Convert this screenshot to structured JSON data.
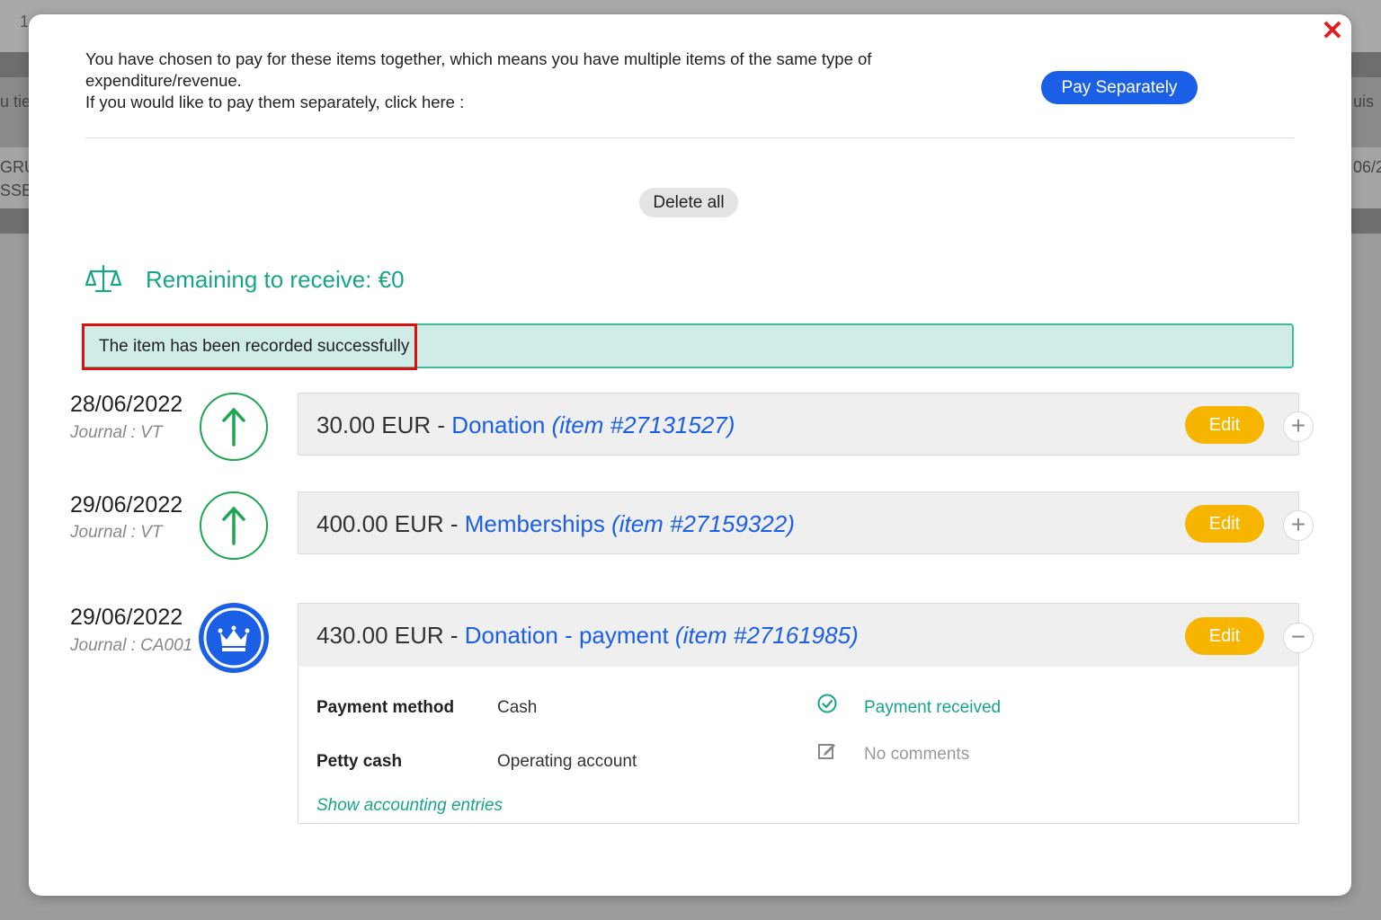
{
  "background": {
    "fragments": [
      "1",
      "u tie",
      "uis",
      "GRUI",
      "SSEA",
      "06/2"
    ]
  },
  "modal": {
    "notice_line1": "You have chosen to pay for these items together, which means you have multiple items of the same type of expenditure/revenue.",
    "notice_line2": "If you would like to pay them separately, click here :",
    "pay_separately_label": "Pay Separately",
    "delete_all_label": "Delete all",
    "remaining_label": "Remaining to receive: €0",
    "success_message": "The item has been recorded successfully"
  },
  "items": [
    {
      "date": "28/06/2022",
      "journal": "Journal : VT",
      "amount": "30.00 EUR",
      "separator": " - ",
      "type": "Donation",
      "ref": "(item #27131527)",
      "edit_label": "Edit",
      "toggle": "+"
    },
    {
      "date": "29/06/2022",
      "journal": "Journal : VT",
      "amount": "400.00 EUR",
      "separator": " - ",
      "type": "Memberships",
      "ref": "(item #27159322)",
      "edit_label": "Edit",
      "toggle": "+"
    },
    {
      "date": "29/06/2022",
      "journal": "Journal : CA001",
      "amount": "430.00 EUR",
      "separator": " - ",
      "type": "Donation - payment",
      "ref": "(item #27161985)",
      "edit_label": "Edit",
      "toggle": "−"
    }
  ],
  "details": {
    "payment_method_label": "Payment method",
    "payment_method_value": "Cash",
    "petty_cash_label": "Petty cash",
    "petty_cash_value": "Operating account",
    "payment_status": "Payment received",
    "comments": "No comments",
    "show_entries_label": "Show accounting entries"
  },
  "colors": {
    "accent_blue": "#1a5fe6",
    "accent_green": "#17a589",
    "edit_orange": "#f7b500",
    "close_red": "#e02020",
    "up_green": "#1ca650"
  }
}
